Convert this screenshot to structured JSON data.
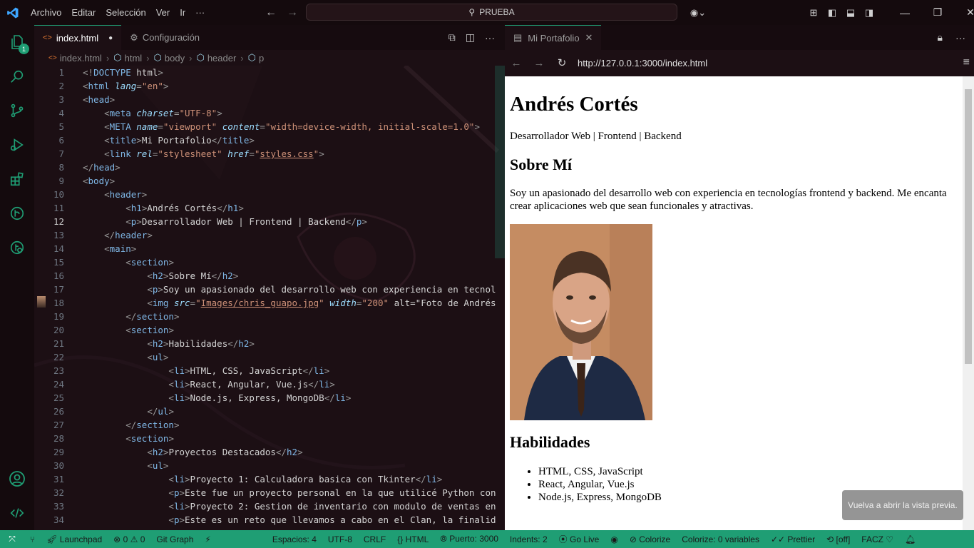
{
  "menu": {
    "items": [
      "Archivo",
      "Editar",
      "Selección",
      "Ver",
      "Ir"
    ],
    "more": "···"
  },
  "search": {
    "text": "PRUEBA"
  },
  "editor": {
    "tabs": [
      {
        "label": "index.html",
        "dirty": true
      },
      {
        "label": "Configuración"
      }
    ],
    "breadcrumb": [
      "index.html",
      "html",
      "body",
      "header",
      "p"
    ]
  },
  "code_lines": [
    "<!DOCTYPE html>",
    "<html lang=\"en\">",
    "<head>",
    "    <meta charset=\"UTF-8\">",
    "    <META name=\"viewport\" content=\"width=device-width, initial-scale=1.0\">",
    "    <title>Mi Portafolio</title>",
    "    <link rel=\"stylesheet\" href=\"styles.css\">",
    "</head>",
    "<body>",
    "    <header>",
    "        <h1>Andrés Cortés</h1>",
    "        <p>Desarrollador Web | Frontend | Backend</p>",
    "    </header>",
    "    <main>",
    "        <section>",
    "            <h2>Sobre Mí</h2>",
    "            <p>Soy un apasionado del desarrollo web con experiencia en tecnol",
    "            <img src=\"Images/chris_guapo.jpg\" width=\"200\" alt=\"Foto de Andrés",
    "        </section>",
    "        <section>",
    "            <h2>Habilidades</h2>",
    "            <ul>",
    "                <li>HTML, CSS, JavaScript</li>",
    "                <li>React, Angular, Vue.js</li>",
    "                <li>Node.js, Express, MongoDB</li>",
    "            </ul>",
    "        </section>",
    "        <section>",
    "            <h2>Proyectos Destacados</h2>",
    "            <ul>",
    "                <li>Proyecto 1: Calculadora basica con Tkinter</li>",
    "                <p>Este fue un proyecto personal en la que utilicé Python con",
    "                <li>Proyecto 2: Gestion de inventario con modulo de ventas en",
    "                <p>Este es un reto que llevamos a cabo en el Clan, la finalid"
  ],
  "current_line": 12,
  "preview": {
    "tab_label": "Mi Portafolio",
    "url": "http://127.0.0.1:3000/index.html",
    "h1": "Andrés Cortés",
    "subtitle": "Desarrollador Web | Frontend | Backend",
    "about_heading": "Sobre Mí",
    "about_text": "Soy un apasionado del desarrollo web con experiencia en tecnologías frontend y backend. Me encanta crear aplicaciones web que sean funcionales y atractivas.",
    "skills_heading": "Habilidades",
    "skills": [
      "HTML, CSS, JavaScript",
      "React, Angular, Vue.js",
      "Node.js, Express, MongoDB"
    ],
    "toast": "Vuelva a abrir la vista previa."
  },
  "status": {
    "launchpad": "Launchpad",
    "errors": "0",
    "warnings": "0",
    "git_graph": "Git Graph",
    "spaces": "Espacios: 4",
    "encoding": "UTF-8",
    "eol": "CRLF",
    "language": "HTML",
    "port": "Puerto: 3000",
    "indents": "Indents: 2",
    "go_live": "Go Live",
    "colorize": "Colorize",
    "colorize_vars": "Colorize: 0 variables",
    "prettier": "Prettier",
    "off": "[off]",
    "user": "FACZ"
  },
  "colors": {
    "accent": "#1f9e74",
    "background": "#1c0f14"
  }
}
